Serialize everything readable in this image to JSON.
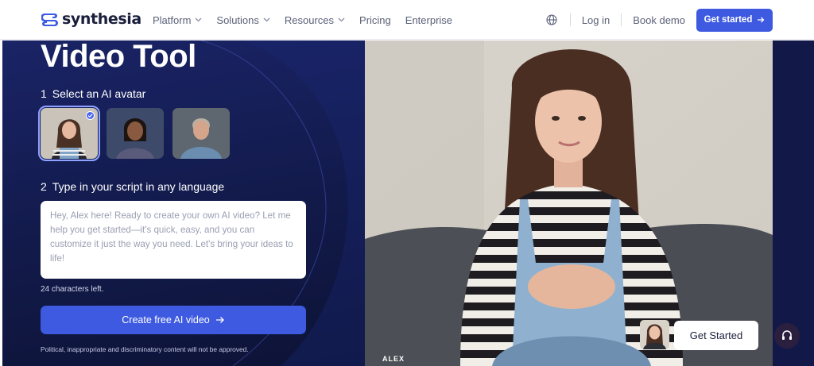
{
  "header": {
    "logo_text": "synthesia",
    "nav": [
      {
        "label": "Platform",
        "has_dropdown": true
      },
      {
        "label": "Solutions",
        "has_dropdown": true
      },
      {
        "label": "Resources",
        "has_dropdown": true
      },
      {
        "label": "Pricing",
        "has_dropdown": false
      },
      {
        "label": "Enterprise",
        "has_dropdown": false
      }
    ],
    "language_icon": "globe-icon",
    "login_label": "Log in",
    "book_demo_label": "Book demo",
    "get_started_label": "Get started"
  },
  "hero": {
    "title": "Video Tool",
    "step1": {
      "number": "1",
      "label": "Select an AI avatar"
    },
    "avatars": [
      {
        "name": "Alex",
        "selected": true
      },
      {
        "name": "avatar-2",
        "selected": false
      },
      {
        "name": "avatar-3",
        "selected": false
      }
    ],
    "step2": {
      "number": "2",
      "label": "Type in your script in any language"
    },
    "script_text": "Hey, Alex here! Ready to create your own AI video? Let me help you get started—it's quick, easy, and you can customize it just the way you need. Let's bring your ideas to life!",
    "chars_left": "24 characters left.",
    "create_button_label": "Create free AI video",
    "disclaimer": "Political, inappropriate and discriminatory content will not be approved."
  },
  "video": {
    "avatar_label": "ALEX"
  },
  "floating": {
    "get_started_label": "Get Started",
    "support_icon": "headset-icon"
  },
  "colors": {
    "accent": "#3d5ae1",
    "hero_bg": "#121a4a",
    "logo": "#1a1f3c"
  }
}
